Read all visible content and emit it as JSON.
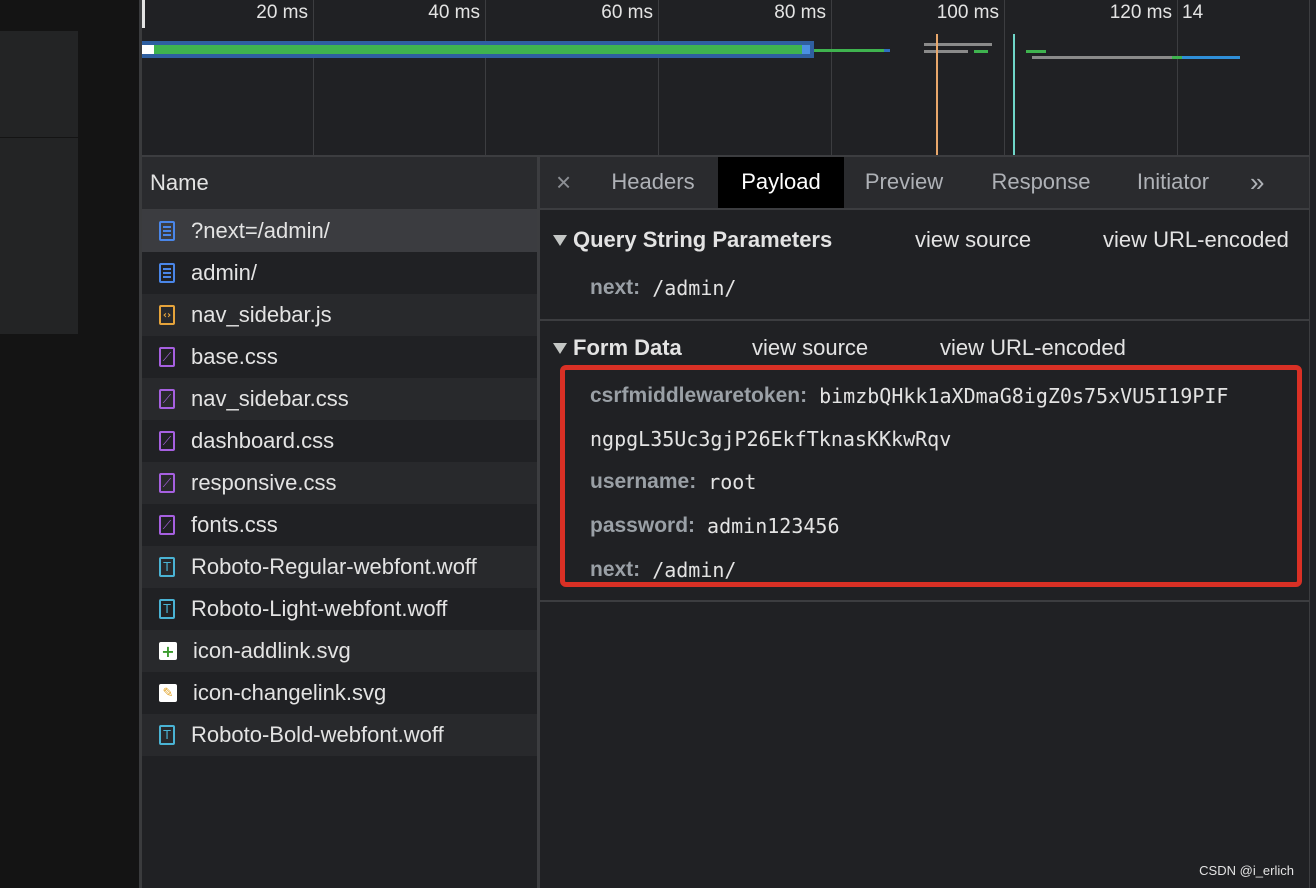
{
  "timeline": {
    "ticks": [
      "20 ms",
      "40 ms",
      "60 ms",
      "80 ms",
      "100 ms",
      "120 ms",
      "14"
    ]
  },
  "name_panel": {
    "header": "Name",
    "rows": [
      {
        "name": "?next=/admin/",
        "icon": "document-icon"
      },
      {
        "name": "admin/",
        "icon": "document-icon"
      },
      {
        "name": "nav_sidebar.js",
        "icon": "script-icon"
      },
      {
        "name": "base.css",
        "icon": "stylesheet-icon"
      },
      {
        "name": "nav_sidebar.css",
        "icon": "stylesheet-icon"
      },
      {
        "name": "dashboard.css",
        "icon": "stylesheet-icon"
      },
      {
        "name": "responsive.css",
        "icon": "stylesheet-icon"
      },
      {
        "name": "fonts.css",
        "icon": "stylesheet-icon"
      },
      {
        "name": "Roboto-Regular-webfont.woff",
        "icon": "font-icon"
      },
      {
        "name": "Roboto-Light-webfont.woff",
        "icon": "font-icon"
      },
      {
        "name": "icon-addlink.svg",
        "icon": "image-add-icon"
      },
      {
        "name": "icon-changelink.svg",
        "icon": "image-edit-icon"
      },
      {
        "name": "Roboto-Bold-webfont.woff",
        "icon": "font-icon"
      }
    ]
  },
  "detail": {
    "close_glyph": "×",
    "tabs": [
      "Headers",
      "Payload",
      "Preview",
      "Response",
      "Initiator"
    ],
    "active_tab": "Payload",
    "more_glyph": "»",
    "query": {
      "title": "Query String Parameters",
      "view_source": "view source",
      "view_encoded": "view URL-encoded",
      "params": [
        {
          "key": "next:",
          "value": "/admin/"
        }
      ]
    },
    "form": {
      "title": "Form Data",
      "view_source": "view source",
      "view_encoded": "view URL-encoded",
      "token_key": "csrfmiddlewaretoken:",
      "token_value_line1": "bimzbQHkk1aXDmaG8igZ0s75xVU5I19PIF",
      "token_value_line2": "ngpgL35Uc3gjP26EkfTknasKKkwRqv",
      "fields": [
        {
          "key": "username:",
          "value": "root"
        },
        {
          "key": "password:",
          "value": "admin123456"
        },
        {
          "key": "next:",
          "value": "/admin/"
        }
      ]
    }
  },
  "colors": {
    "highlight_box": "#d93025",
    "bar_blue": "#2f6fbf",
    "bar_green": "#3fb34f"
  },
  "watermark": "CSDN @i_erlich"
}
